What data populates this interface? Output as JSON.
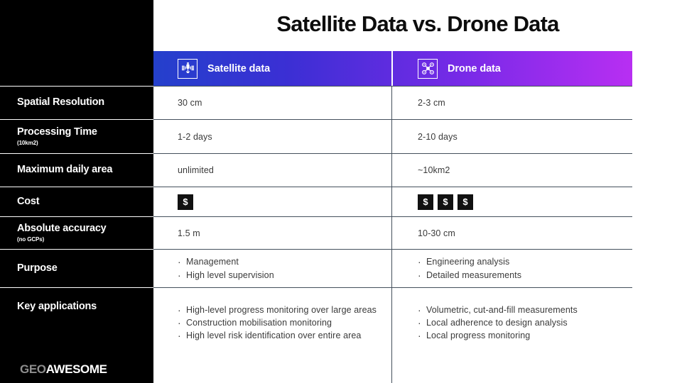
{
  "title": "Satellite Data vs. Drone Data",
  "brand": {
    "logo_part1": "GEO",
    "logo_part2": "AWESOME"
  },
  "colors": {
    "sidebar_bg": "#000000",
    "gradient_start": "#2440cc",
    "gradient_end": "#b82ff2",
    "text": "#3a3a3a",
    "divider": "#44505c"
  },
  "columns": [
    {
      "label": "Satellite data",
      "icon": "satellite-icon"
    },
    {
      "label": "Drone data",
      "icon": "drone-icon"
    }
  ],
  "rows": [
    {
      "label": "Spatial Resolution",
      "sublabel": "",
      "satellite": {
        "type": "text",
        "value": "30 cm"
      },
      "drone": {
        "type": "text",
        "value": "2-3 cm"
      }
    },
    {
      "label": "Processing Time",
      "sublabel": "(10km2)",
      "satellite": {
        "type": "text",
        "value": "1-2 days"
      },
      "drone": {
        "type": "text",
        "value": "2-10 days"
      }
    },
    {
      "label": "Maximum daily area",
      "sublabel": "",
      "satellite": {
        "type": "text",
        "value": "unlimited"
      },
      "drone": {
        "type": "text",
        "value": "~10km2"
      }
    },
    {
      "label": "Cost",
      "sublabel": "",
      "satellite": {
        "type": "cost",
        "count": 1,
        "symbol": "$"
      },
      "drone": {
        "type": "cost",
        "count": 3,
        "symbol": "$"
      }
    },
    {
      "label": "Absolute accuracy",
      "sublabel": "(no GCPs)",
      "satellite": {
        "type": "text",
        "value": "1.5 m"
      },
      "drone": {
        "type": "text",
        "value": "10-30 cm"
      }
    },
    {
      "label": "Purpose",
      "sublabel": "",
      "satellite": {
        "type": "list",
        "items": [
          "Management",
          "High level supervision"
        ]
      },
      "drone": {
        "type": "list",
        "items": [
          "Engineering analysis",
          "Detailed measurements"
        ]
      }
    },
    {
      "label": "Key applications",
      "sublabel": "",
      "satellite": {
        "type": "list",
        "items": [
          "High-level progress monitoring over large areas",
          "Construction mobilisation monitoring",
          "High level risk identification over entire area"
        ]
      },
      "drone": {
        "type": "list",
        "items": [
          "Volumetric, cut-and-fill measurements",
          "Local adherence to design analysis",
          "Local progress monitoring"
        ]
      }
    }
  ]
}
